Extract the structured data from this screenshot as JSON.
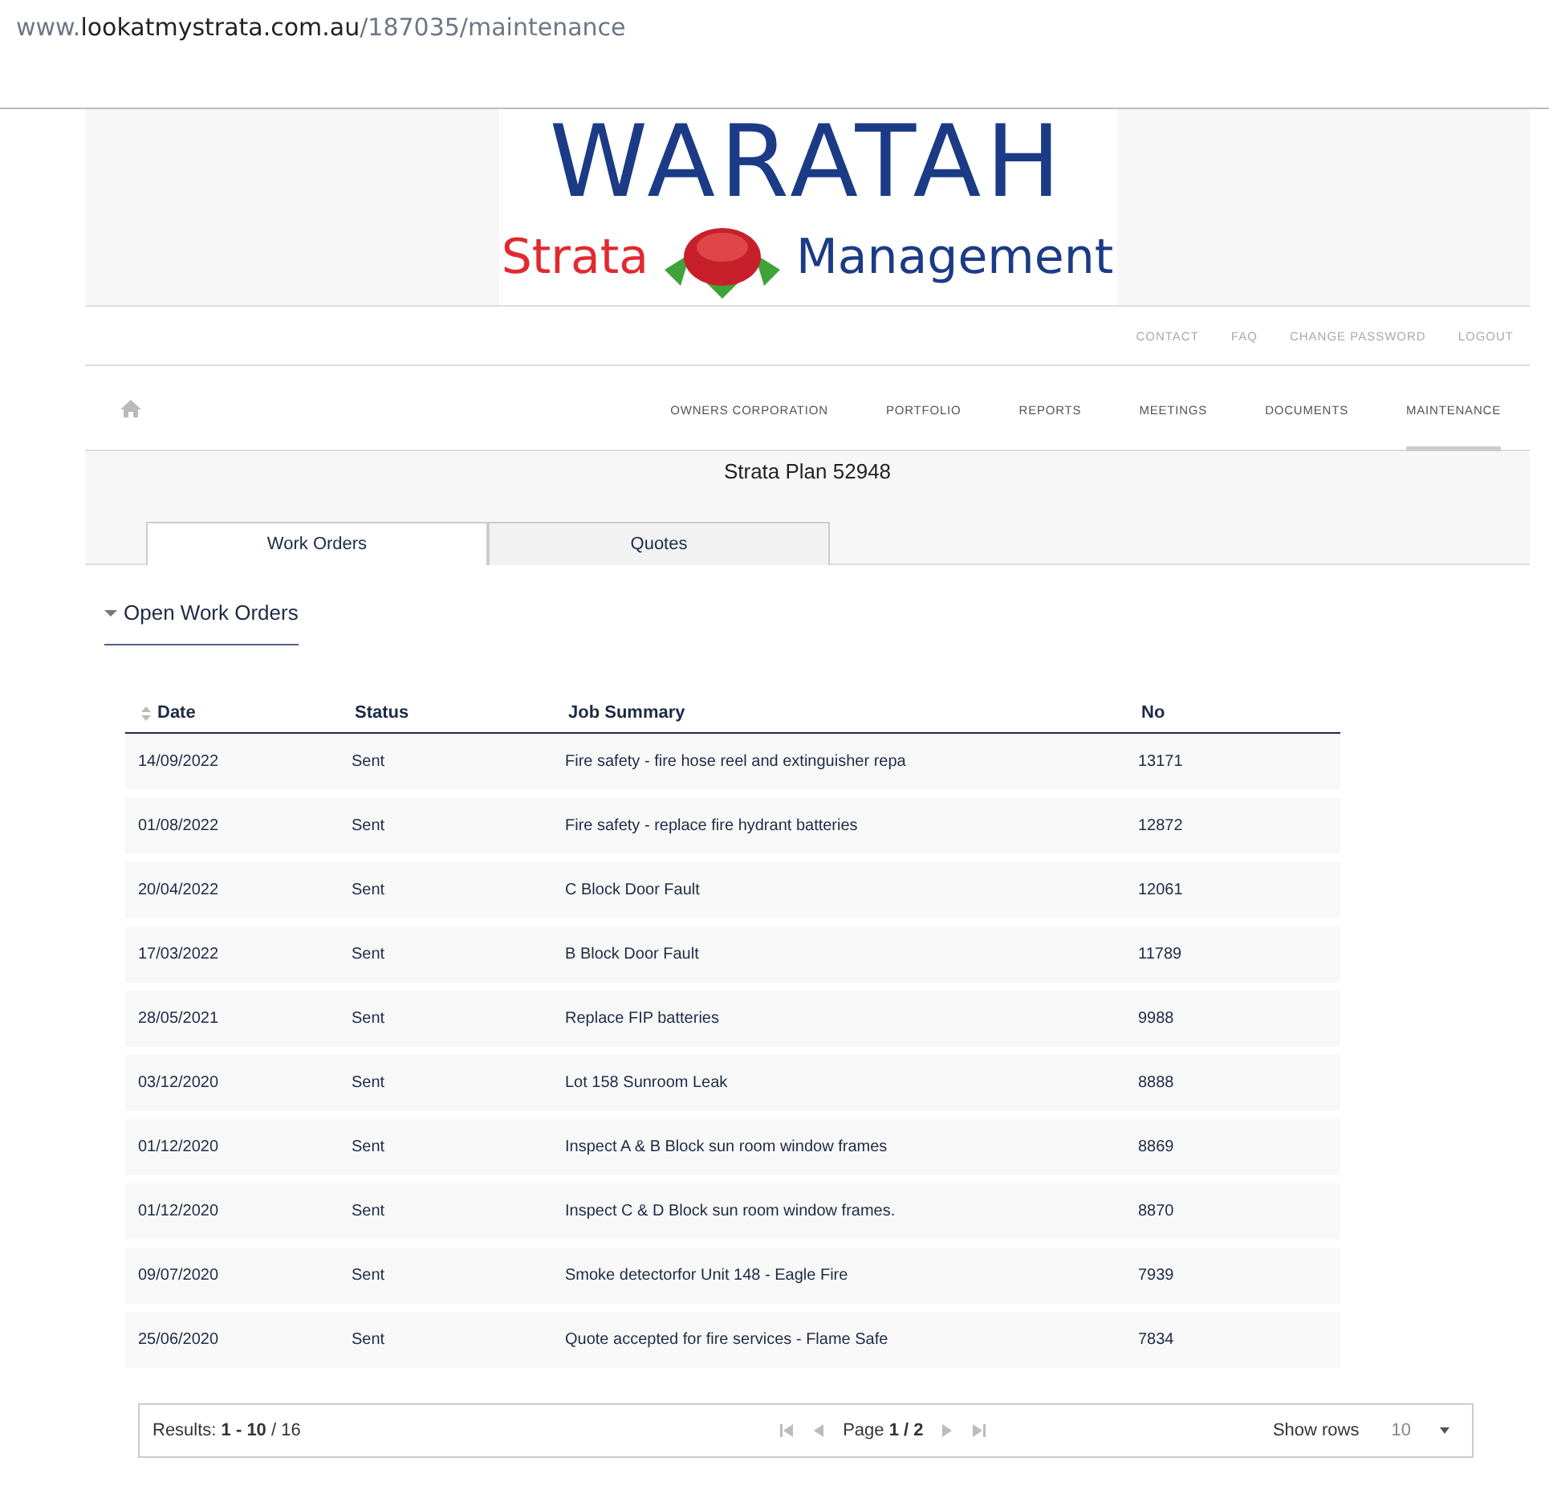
{
  "address_bar": {
    "domain_prefix": "www.",
    "domain": "lookatmystrata.com.au",
    "path": "/187035/maintenance"
  },
  "logo": {
    "title": "WARATAH",
    "left_word": "Strata",
    "right_word": "Management"
  },
  "top_links": [
    "CONTACT",
    "FAQ",
    "CHANGE PASSWORD",
    "LOGOUT"
  ],
  "nav": [
    {
      "label": "OWNERS CORPORATION",
      "selected": false
    },
    {
      "label": "PORTFOLIO",
      "selected": false
    },
    {
      "label": "REPORTS",
      "selected": false
    },
    {
      "label": "MEETINGS",
      "selected": false
    },
    {
      "label": "DOCUMENTS",
      "selected": false
    },
    {
      "label": "MAINTENANCE",
      "selected": true
    }
  ],
  "page_title": "Strata Plan 52948",
  "tabs": [
    {
      "label": "Work Orders",
      "selected": true
    },
    {
      "label": "Quotes",
      "selected": false
    }
  ],
  "section": {
    "title": "Open Work Orders",
    "expanded": true
  },
  "table": {
    "columns": [
      "Date",
      "Status",
      "Job Summary",
      "No"
    ],
    "rows": [
      [
        "14/09/2022",
        "Sent",
        "Fire safety - fire hose reel and extinguisher repa",
        "13171"
      ],
      [
        "01/08/2022",
        "Sent",
        "Fire safety - replace fire hydrant batteries",
        "12872"
      ],
      [
        "20/04/2022",
        "Sent",
        "C Block Door Fault",
        "12061"
      ],
      [
        "17/03/2022",
        "Sent",
        "B Block Door Fault",
        "11789"
      ],
      [
        "28/05/2021",
        "Sent",
        "Replace FIP batteries",
        "9988"
      ],
      [
        "03/12/2020",
        "Sent",
        "Lot 158 Sunroom Leak",
        "8888"
      ],
      [
        "01/12/2020",
        "Sent",
        "Inspect A & B Block sun room window frames",
        "8869"
      ],
      [
        "01/12/2020",
        "Sent",
        "Inspect C & D Block sun room window frames.",
        "8870"
      ],
      [
        "09/07/2020",
        "Sent",
        "Smoke detectorfor Unit 148 - Eagle Fire",
        "7939"
      ],
      [
        "25/06/2020",
        "Sent",
        "Quote accepted for fire services - Flame Safe",
        "7834"
      ]
    ]
  },
  "pagination": {
    "results": "Results: **1 - 10** / 16",
    "page": "Page **1 / 2**",
    "show_rows_label": "Show rows",
    "rows_value": "10"
  }
}
